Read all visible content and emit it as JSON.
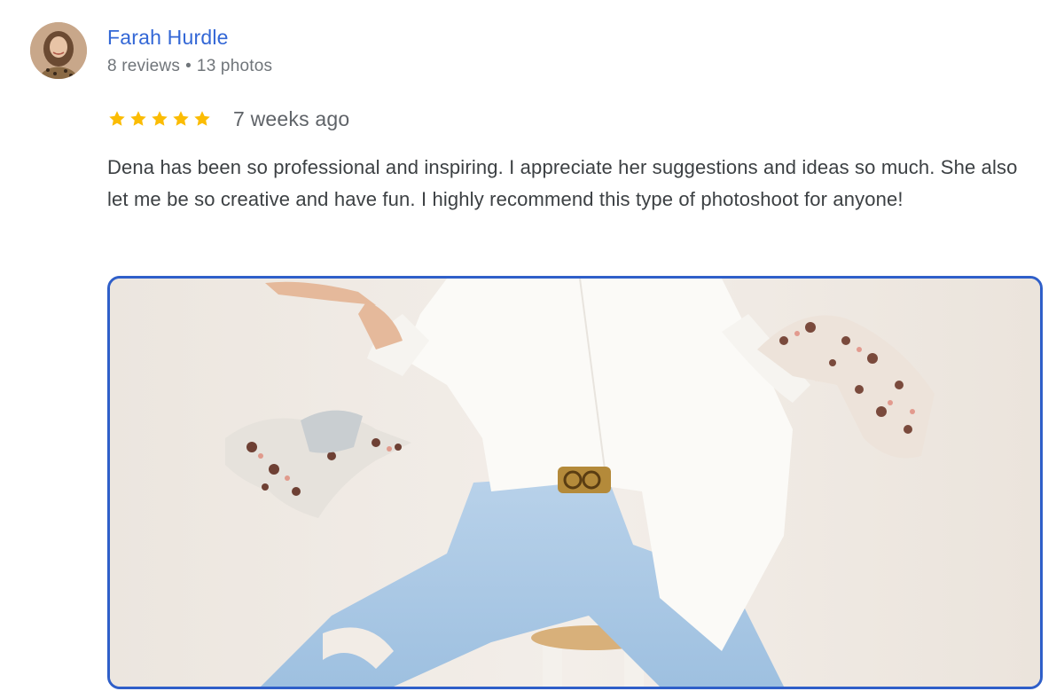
{
  "review": {
    "author": {
      "name": "Farah Hurdle",
      "reviews": "8 reviews",
      "separator": "•",
      "photos": "13 photos",
      "avatar_icon": "user-avatar-photo"
    },
    "rating": {
      "stars": 5,
      "max_stars": 5,
      "star_color": "#fbbc04"
    },
    "date": "7 weeks ago",
    "text": "Dena has been so professional and inspiring. I appreciate her suggestions and ideas so much. She also let me be so creative and have fun. I highly recommend this type of photoshoot for anyone!",
    "photo": {
      "icon": "review-photo",
      "border_color": "#2f5fc9"
    }
  },
  "colors": {
    "author_link": "#3367d6",
    "meta_text": "#70757a",
    "body_text": "#3c4043"
  }
}
